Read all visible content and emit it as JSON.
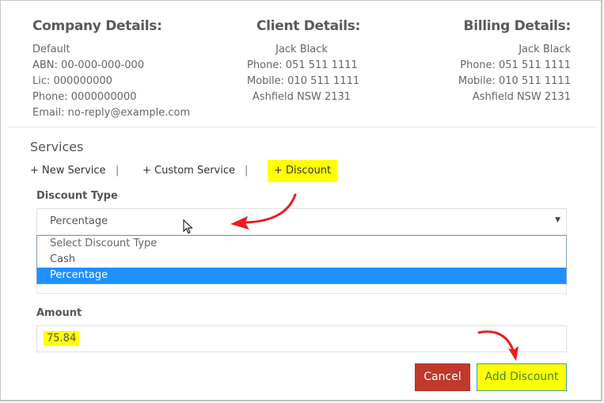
{
  "company": {
    "title": "Company Details:",
    "lines": [
      "Default",
      "ABN: 00-000-000-000",
      "Lic: 000000000",
      "Phone: 0000000000",
      "Email: no-reply@example.com"
    ]
  },
  "client": {
    "title": "Client Details:",
    "lines": [
      "Jack Black",
      "Phone: 051 511 1111",
      "Mobile: 010 511 1111",
      "Ashfield NSW 2131"
    ]
  },
  "billing": {
    "title": "Billing Details:",
    "lines": [
      "Jack Black",
      "Phone: 051 511 1111",
      "Mobile: 010 511 1111",
      "Ashfield NSW 2131"
    ]
  },
  "services": {
    "title": "Services",
    "links": {
      "new_service": "+ New Service",
      "custom_service": "+ Custom Service",
      "discount": "+ Discount",
      "separator": "|"
    }
  },
  "form": {
    "discount_type_label": "Discount Type",
    "discount_type_value": "Percentage",
    "discount_type_options": [
      "Select Discount Type",
      "Cash",
      "Percentage"
    ],
    "discount_type_selected_index": 2,
    "caret_icon": "▼",
    "amount_label": "Amount",
    "amount_value": "75.84"
  },
  "buttons": {
    "cancel": "Cancel",
    "add_discount": "Add Discount"
  },
  "annotations": {
    "highlight_color": "#ffff00",
    "arrow_color": "#ee1c1c"
  }
}
